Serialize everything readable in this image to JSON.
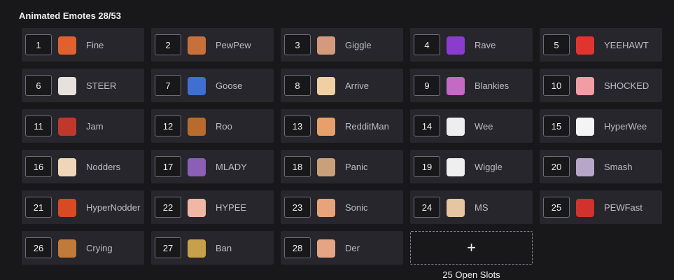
{
  "header": {
    "title": "Animated Emotes 28/53"
  },
  "emotes": [
    {
      "num": "1",
      "name": "Fine",
      "color": "#e0612d"
    },
    {
      "num": "2",
      "name": "PewPew",
      "color": "#c8703a"
    },
    {
      "num": "3",
      "name": "Giggle",
      "color": "#d49a7c"
    },
    {
      "num": "4",
      "name": "Rave",
      "color": "#8a3ccf"
    },
    {
      "num": "5",
      "name": "YEEHAWT",
      "color": "#e0352f"
    },
    {
      "num": "6",
      "name": "STEER",
      "color": "#e6e1da"
    },
    {
      "num": "7",
      "name": "Goose",
      "color": "#3f6fd1"
    },
    {
      "num": "8",
      "name": "Arrive",
      "color": "#f0cfa4"
    },
    {
      "num": "9",
      "name": "Blankies",
      "color": "#c46ac4"
    },
    {
      "num": "10",
      "name": "SHOCKED",
      "color": "#f29ca6"
    },
    {
      "num": "11",
      "name": "Jam",
      "color": "#c0372c"
    },
    {
      "num": "12",
      "name": "Roo",
      "color": "#b86b2c"
    },
    {
      "num": "13",
      "name": "RedditMan",
      "color": "#e7a06a"
    },
    {
      "num": "14",
      "name": "Wee",
      "color": "#eeeeee"
    },
    {
      "num": "15",
      "name": "HyperWee",
      "color": "#f4f4f4"
    },
    {
      "num": "16",
      "name": "Nodders",
      "color": "#efd6b8"
    },
    {
      "num": "17",
      "name": "MLADY",
      "color": "#8a5fb5"
    },
    {
      "num": "18",
      "name": "Panic",
      "color": "#caa07a"
    },
    {
      "num": "19",
      "name": "Wiggle",
      "color": "#efefef"
    },
    {
      "num": "20",
      "name": "Smash",
      "color": "#b7a6c7"
    },
    {
      "num": "21",
      "name": "HyperNodders",
      "color": "#d74a24"
    },
    {
      "num": "22",
      "name": "HYPEE",
      "color": "#f0b8a4"
    },
    {
      "num": "23",
      "name": "Sonic",
      "color": "#e7a47a"
    },
    {
      "num": "24",
      "name": "MS",
      "color": "#e6c6a0"
    },
    {
      "num": "25",
      "name": "PEWFast",
      "color": "#d2322d"
    },
    {
      "num": "26",
      "name": "Crying",
      "color": "#c07a3a"
    },
    {
      "num": "27",
      "name": "Ban",
      "color": "#c6a04a"
    },
    {
      "num": "28",
      "name": "Der",
      "color": "#e5a484"
    }
  ],
  "add_slot": {
    "label": "+",
    "caption": "25 Open Slots"
  }
}
